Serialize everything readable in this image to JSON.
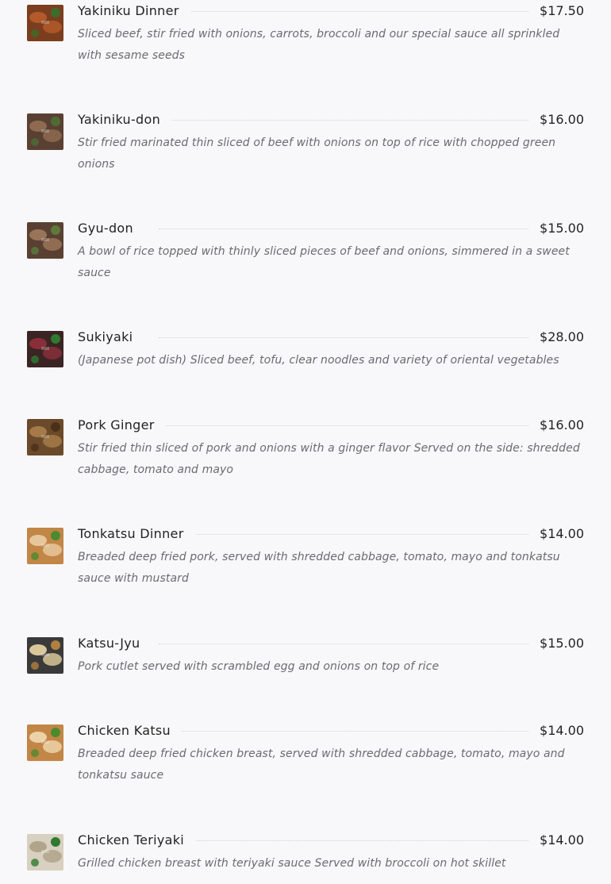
{
  "menu": {
    "items": [
      {
        "name": "Yakiniku Dinner",
        "price": "$17.50",
        "description": "Sliced beef, stir fried with onions, carrots, broccoli and our special sauce all sprinkled with sesame seeds",
        "photo": "beef-stirfry-photo",
        "colors": {
          "base": "#7a3e1e",
          "accent1": "#b35a2c",
          "accent2": "#3c6d2a"
        }
      },
      {
        "name": "Yakiniku-don",
        "price": "$16.00",
        "description": "Stir fried marinated thin sliced of beef with onions on top of rice with chopped green onions",
        "photo": "beef-rice-bowl-photo",
        "colors": {
          "base": "#5a4032",
          "accent1": "#8e6a50",
          "accent2": "#4e6b35"
        }
      },
      {
        "name": "Gyu-don",
        "price": "$15.00",
        "description": "A bowl of rice topped with thinly sliced pieces of beef and onions, simmered in a sweet sauce",
        "photo": "beef-bowl-photo",
        "colors": {
          "base": "#5a4032",
          "accent1": "#9a7458",
          "accent2": "#5b7a3c"
        }
      },
      {
        "name": "Sukiyaki",
        "price": "$28.00",
        "description": "(Japanese pot dish) Sliced beef, tofu, clear noodles and variety of oriental vegetables",
        "photo": "hot-pot-photo",
        "colors": {
          "base": "#3a2424",
          "accent1": "#8a2f3a",
          "accent2": "#2f7a30"
        }
      },
      {
        "name": "Pork Ginger",
        "price": "$16.00",
        "description": "Stir fried thin sliced of pork and onions with a ginger flavor Served on the side: shredded cabbage, tomato and mayo",
        "photo": "pork-ginger-photo",
        "colors": {
          "base": "#6a4a2a",
          "accent1": "#a57a48",
          "accent2": "#4a3018"
        }
      },
      {
        "name": "Tonkatsu Dinner",
        "price": "$14.00",
        "description": "Breaded deep fried pork, served with shredded cabbage, tomato, mayo and tonkatsu sauce with mustard",
        "photo": "tonkatsu-photo",
        "colors": {
          "base": "#c28646",
          "accent1": "#e6c79c",
          "accent2": "#4d8a2e"
        }
      },
      {
        "name": "Katsu-Jyu",
        "price": "$15.00",
        "description": "Pork cutlet served with scrambled egg and onions on top of rice",
        "photo": "katsu-rice-photo",
        "colors": {
          "base": "#3a3a3a",
          "accent1": "#d9c79a",
          "accent2": "#b08040"
        }
      },
      {
        "name": "Chicken Katsu",
        "price": "$14.00",
        "description": "Breaded deep fried chicken breast, served with shredded cabbage, tomato, mayo and tonkatsu sauce",
        "photo": "chicken-katsu-photo",
        "colors": {
          "base": "#c28646",
          "accent1": "#ecd2a8",
          "accent2": "#4d8a2e"
        }
      },
      {
        "name": "Chicken Teriyaki",
        "price": "$14.00",
        "description": "Grilled chicken breast with teriyaki sauce Served with broccoli on hot skillet",
        "photo": "chicken-teriyaki-photo",
        "colors": {
          "base": "#d8d0c0",
          "accent1": "#b0a48a",
          "accent2": "#2f7a30"
        }
      }
    ]
  }
}
